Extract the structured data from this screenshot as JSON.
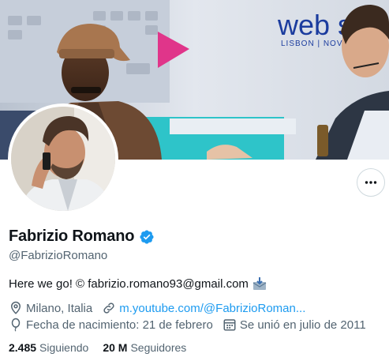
{
  "profile": {
    "name": "Fabrizio Romano",
    "handle": "@FabrizioRomano",
    "bio": "Here we go! © fabrizio.romano93@gmail.com",
    "location": "Milano, Italia",
    "website": "m.youtube.com/@FabrizioRoman...",
    "birthday": "Fecha de nacimiento: 21 de febrero",
    "joined": "Se unió en julio de 2011"
  },
  "stats": {
    "following_count": "2.485",
    "following_label": "Siguiendo",
    "followers_count": "20 M",
    "followers_label": "Seguidores"
  },
  "banner": {
    "sign_text": "web s",
    "sign_subtext": "LISBON | NOVE"
  },
  "icons": {
    "verified": "verified-badge-icon",
    "bio_emoji": "incoming-envelope-icon",
    "location": "location-pin-icon",
    "website": "link-icon",
    "birthday": "balloon-icon",
    "joined": "calendar-icon",
    "more": "more-dots-icon"
  },
  "colors": {
    "accent": "#1d9bf0",
    "text_primary": "#0f1419",
    "text_secondary": "#536471",
    "border": "#cfd9de"
  }
}
